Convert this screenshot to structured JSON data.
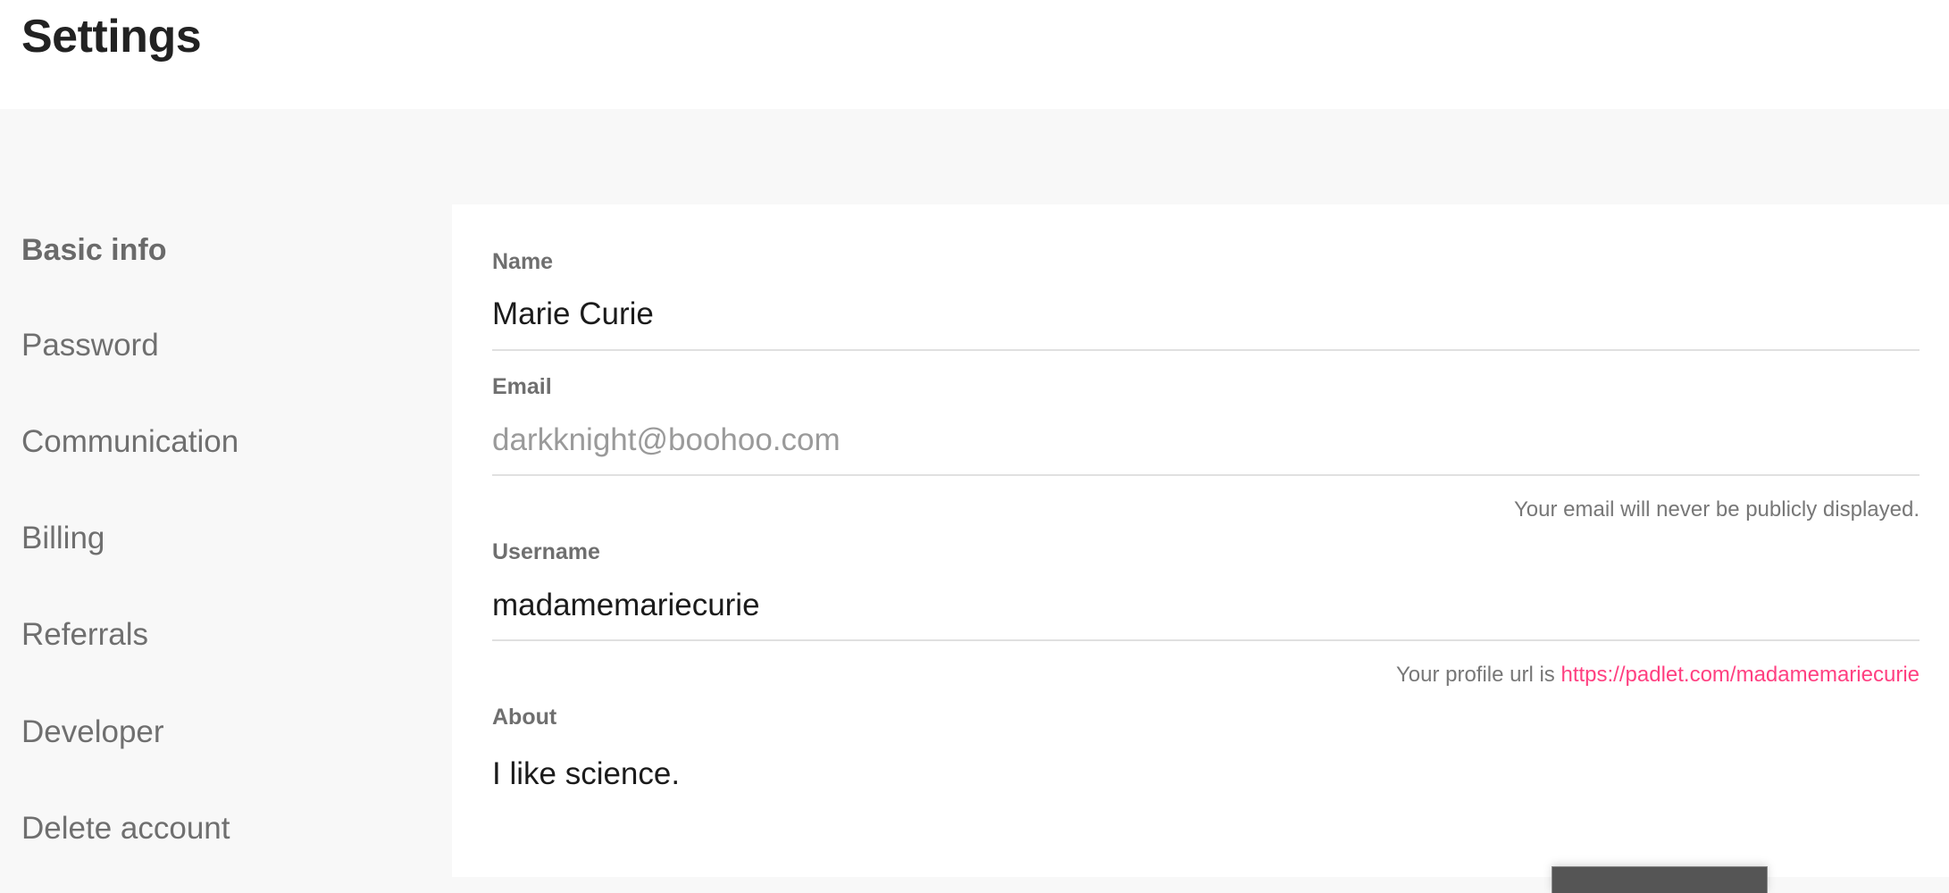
{
  "header": {
    "title": "Settings"
  },
  "sidebar": {
    "items": [
      {
        "label": "Basic info",
        "active": true
      },
      {
        "label": "Password",
        "active": false
      },
      {
        "label": "Communication",
        "active": false
      },
      {
        "label": "Billing",
        "active": false
      },
      {
        "label": "Referrals",
        "active": false
      },
      {
        "label": "Developer",
        "active": false
      },
      {
        "label": "Delete account",
        "active": false
      }
    ]
  },
  "form": {
    "name": {
      "label": "Name",
      "value": "Marie Curie"
    },
    "email": {
      "label": "Email",
      "value": "darkknight@boohoo.com",
      "helper": "Your email will never be publicly displayed."
    },
    "username": {
      "label": "Username",
      "value": "madamemariecurie",
      "helper_prefix": "Your profile url is",
      "profile_url": "https://padlet.com/madamemariecurie"
    },
    "about": {
      "label": "About",
      "value": "I like science."
    }
  },
  "colors": {
    "accent_link": "#ff4081",
    "background": "#f8f8f8",
    "card": "#ffffff",
    "nav_text": "#6f6f6f",
    "title_text": "#222222"
  }
}
